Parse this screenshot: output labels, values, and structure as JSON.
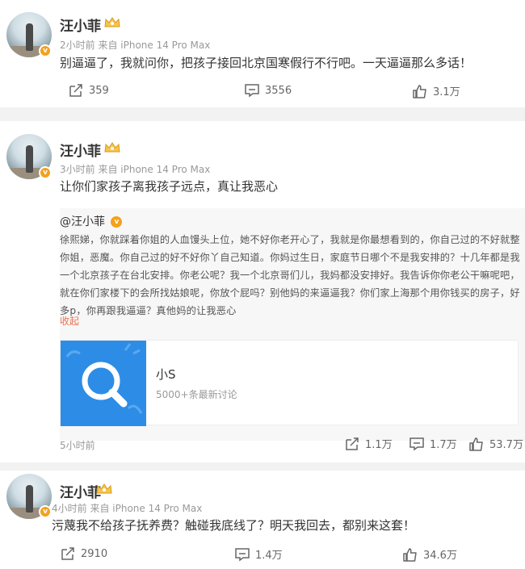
{
  "posts": [
    {
      "author": "汪小菲",
      "meta": "2小时前  来自 iPhone 14 Pro Max",
      "text": "别逼逼了，我就问你，把孩子接回北京国寒假行不行吧。一天逼逼那么多话！",
      "reposts": "359",
      "comments": "3556",
      "likes": "3.1万"
    },
    {
      "author": "汪小菲",
      "meta": "3小时前  来自 iPhone 14 Pro Max",
      "text": "让你们家孩子离我孩子远点，真让我恶心",
      "repost": {
        "name": "@汪小菲",
        "text": "徐熙娣，你就踩着你姐的人血馒头上位，她不好你老开心了，我就是你最想看到的，你自己过的不好就整你姐，恶魔。你自己过的好不好你丫自己知道。你妈过生日，家庭节日哪个不是我安排的？十几年都是我一个北京孩子在台北安排。你老公呢？我一个北京哥们儿，我妈都没安排好。我告诉你你老公干嘛呢吧，就在你们家楼下的会所找姑娘呢，你放个屁吗？别他妈的来逼逼我？你们家上海那个用你钱买的房子，好多p，你再跟我逼逼？真他妈的让我恶心",
        "collapse": "收起",
        "link_title": "小S",
        "link_sub": "5000+条最新讨论",
        "time": "5小时前",
        "reposts": "1.1万",
        "comments": "1.7万",
        "likes": "53.7万"
      }
    },
    {
      "author": "汪小菲",
      "meta": "4小时前  来自 iPhone 14 Pro Max",
      "text": "污蔑我不给孩子抚养费？触碰我底线了？明天我回去，都别来这套！",
      "reposts": "2910",
      "comments": "1.4万",
      "likes": "34.6万"
    }
  ],
  "colors": {
    "accent": "#eb7350",
    "badge": "#f4a11c",
    "link_thumb": "#2d8de6"
  },
  "icons": [
    "repost-icon",
    "comment-icon",
    "like-icon",
    "verified-icon",
    "crown-icon",
    "search-icon"
  ]
}
